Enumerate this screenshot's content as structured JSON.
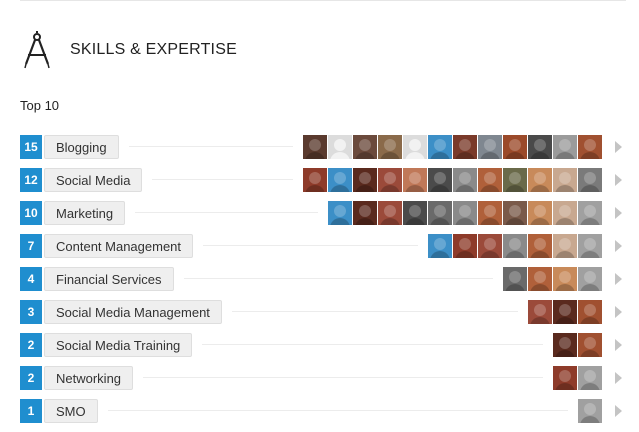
{
  "section": {
    "title": "SKILLS & EXPERTISE",
    "icon": "compass-icon"
  },
  "subtitle": "Top 10",
  "colors": {
    "badge": "#1f8ecf",
    "pill_bg": "#efefef"
  },
  "skills": [
    {
      "count": "15",
      "name": "Blogging",
      "avatars": [
        "#5a3a2e",
        "placeholder",
        "#6b4a3c",
        "#8a6a4a",
        "placeholder",
        "#3c8fc7",
        "#7a3a2a",
        "#7f8790",
        "#9b4a2a",
        "#4a4a4a",
        "#9b9b9b",
        "#a05030"
      ]
    },
    {
      "count": "12",
      "name": "Social Media",
      "avatars": [
        "#8e3b2a",
        "#3c8fc7",
        "#5a2a1e",
        "#9b4a3a",
        "#c07858",
        "#4b4b4b",
        "#8a8a8a",
        "#b0603a",
        "#6a6a4a",
        "#c88a5a",
        "#c8a890",
        "#7a7a7a"
      ]
    },
    {
      "count": "10",
      "name": "Marketing",
      "avatars": [
        "#3c8fc7",
        "#5a2a1e",
        "#9b4a3a",
        "#4b4b4b",
        "#6a6a6a",
        "#8a8a8a",
        "#b0603a",
        "#7a5a4a",
        "#c88a5a",
        "#c8a890",
        "#a0a0a0"
      ]
    },
    {
      "count": "7",
      "name": "Content Management",
      "avatars": [
        "#3c8fc7",
        "#8e3b2a",
        "#9b4a3a",
        "#8a8a8a",
        "#b0603a",
        "#c8a890",
        "#a0a0a0"
      ]
    },
    {
      "count": "4",
      "name": "Financial Services",
      "avatars": [
        "#6a6a6a",
        "#b0603a",
        "#c88a5a",
        "#a0a0a0"
      ]
    },
    {
      "count": "3",
      "name": "Social Media Management",
      "avatars": [
        "#9b4a3a",
        "#5a2a1e",
        "#a05030"
      ]
    },
    {
      "count": "2",
      "name": "Social Media Training",
      "avatars": [
        "#5a2a1e",
        "#a05030"
      ]
    },
    {
      "count": "2",
      "name": "Networking",
      "avatars": [
        "#8e3b2a",
        "#a0a0a0"
      ]
    },
    {
      "count": "1",
      "name": "SMO",
      "avatars": [
        "#a0a0a0"
      ]
    }
  ]
}
